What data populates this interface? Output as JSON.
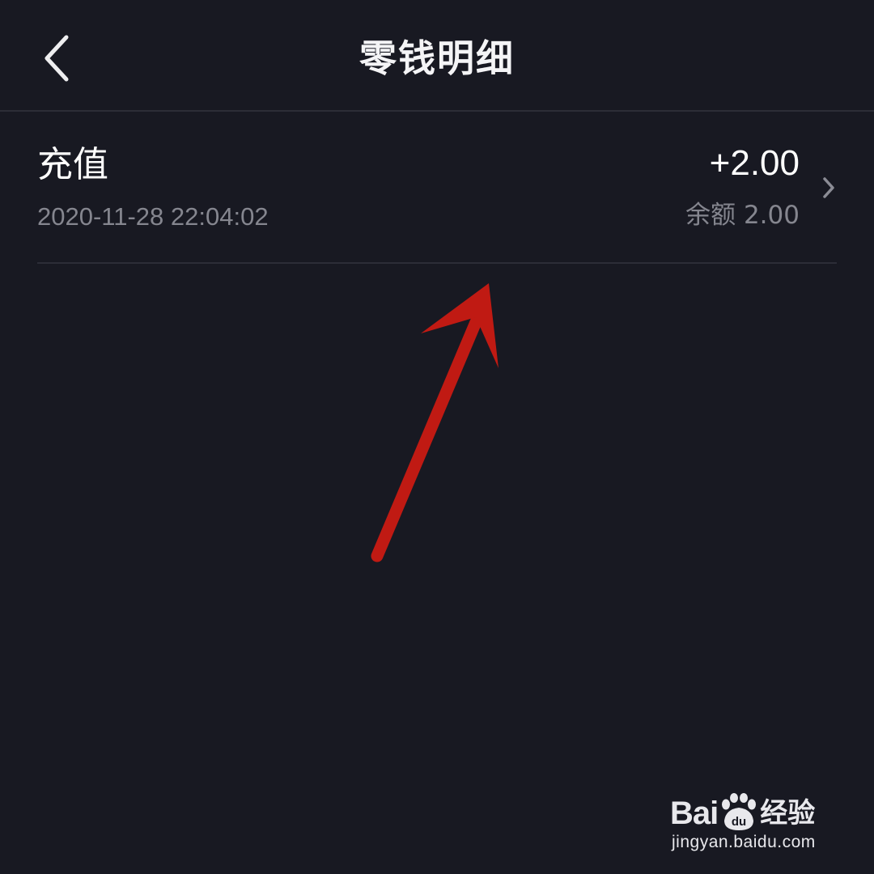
{
  "header": {
    "title": "零钱明细",
    "back_icon": "chevron-left-icon"
  },
  "transactions": [
    {
      "type": "充值",
      "time": "2020-11-28 22:04:02",
      "amount": "+2.00",
      "balance": "余额 2.00"
    }
  ],
  "watermark": {
    "brand_prefix": "Bai",
    "brand_suffix": "经验",
    "url": "jingyan.baidu.com",
    "paw_text": "du"
  },
  "colors": {
    "background": "#181922",
    "divider": "#2c2d37",
    "secondary_text": "#85868f",
    "annotation_arrow": "#c01a13"
  }
}
